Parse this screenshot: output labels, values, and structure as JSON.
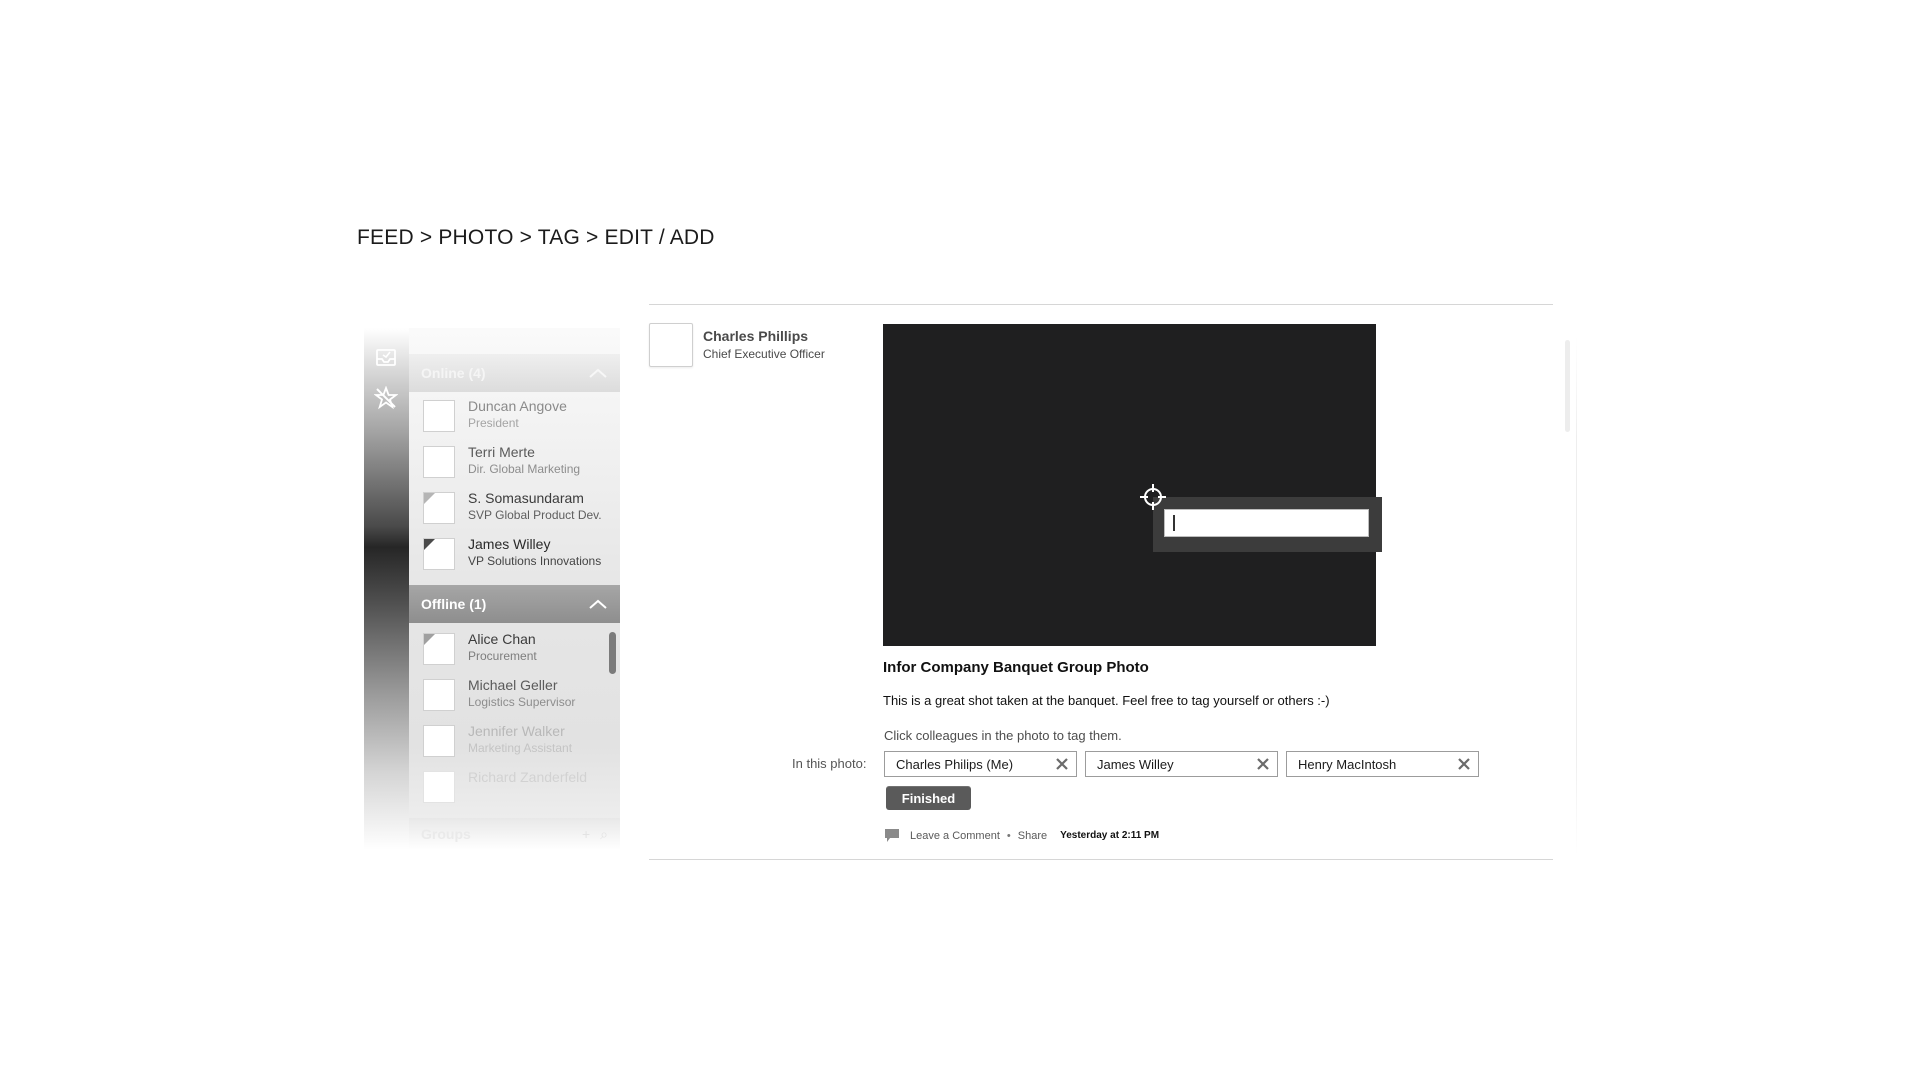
{
  "breadcrumb": "FEED > PHOTO > TAG > EDIT / ADD",
  "sidebar": {
    "icons": [
      "inbox-icon",
      "no-star-icon"
    ],
    "online_header": "Online (4)",
    "offline_header": "Offline (1)",
    "groups_header": "Groups",
    "groups_add": "+",
    "groups_search": "⌕",
    "online": [
      {
        "name": "Duncan Angove",
        "title": "President"
      },
      {
        "name": "Terri Merte",
        "title": "Dir. Global Marketing"
      },
      {
        "name": "S. Somasundaram",
        "title": "SVP Global Product Dev."
      },
      {
        "name": "James Willey",
        "title": "VP Solutions Innovations"
      }
    ],
    "offline": [
      {
        "name": "Alice Chan",
        "title": "Procurement"
      },
      {
        "name": "Michael Geller",
        "title": "Logistics Supervisor"
      },
      {
        "name": "Jennifer Walker",
        "title": "Marketing Assistant"
      },
      {
        "name": "Richard Zanderfeld",
        "title": ""
      }
    ]
  },
  "post": {
    "author_name": "Charles Phillips",
    "author_title": "Chief Executive Officer",
    "tag_input_value": "",
    "title": "Infor Company Banquet Group Photo",
    "description": "This is a great shot taken at the banquet. Feel free to tag yourself or others :-)",
    "hint": "Click colleagues in the photo to tag them.",
    "in_photo_label": "In this photo:",
    "tags": [
      "Charles Philips (Me)",
      "James Willey",
      "Henry MacIntosh"
    ],
    "finished_label": "Finished",
    "actions": {
      "comment": "Leave a Comment",
      "separator": "•",
      "share": "Share",
      "timestamp": "Yesterday at 2:11 PM"
    }
  },
  "colors": {
    "photo_bg": "#1f1f20",
    "tag_popup": "#3c3c3c",
    "button": "#5a5a5a"
  }
}
